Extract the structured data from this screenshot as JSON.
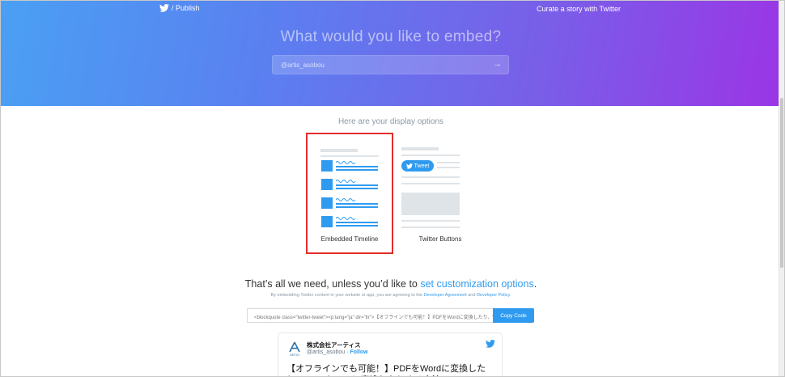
{
  "topnav": {
    "logo_icon": "twitter-bird-icon",
    "publish_label": "/ Publish",
    "curate_link": "Curate a story with Twitter"
  },
  "hero": {
    "title": "What would you like to embed?",
    "input_value": "@artis_asobou",
    "submit_icon": "arrow-right-icon"
  },
  "display_options": {
    "heading": "Here are your display options",
    "options": [
      {
        "label": "Embedded Timeline",
        "selected": true
      },
      {
        "label": "Twitter Buttons",
        "selected": false,
        "pill_label": "Tweet"
      }
    ]
  },
  "customize": {
    "headline_prefix": "That’s all we need, unless you’d like to",
    "headline_link": "set customization options",
    "headline_suffix": ".",
    "terms_prefix": "By embedding Twitter content in your website or app, you are agreeing to the",
    "terms_link_1": "Developer Agreement",
    "terms_and": "and",
    "terms_link_2": "Developer Policy",
    "terms_suffix": "."
  },
  "embed_code": {
    "value": "<blockquote class=\"twitter-tweet\"><p lang=\"ja\" dir=\"ltr\">【オフラインでも可能！】PDFをWordに変換したり、WordをPDFに変換したりする方法",
    "copy_label": "Copy Code"
  },
  "preview": {
    "name": "株式会社アーティス",
    "handle": "@artis_asobou",
    "separator": " · ",
    "follow_label": "Follow",
    "avatar_text": "ARTIS",
    "text": "【オフラインでも可能！】PDFをWordに変換したり、WordをPDFに変換したりする方法"
  },
  "colors": {
    "accent": "#2f9bf0",
    "highlight_border": "#e32c2c",
    "gradient_start": "#4aa0f4",
    "gradient_end": "#9b35e6"
  }
}
